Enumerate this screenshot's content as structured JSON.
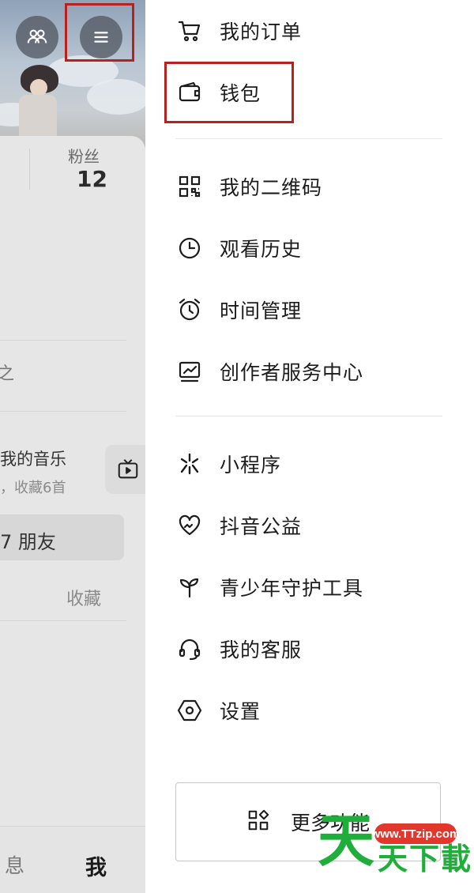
{
  "profile": {
    "fans_label": "粉丝",
    "fans_count": "12",
    "partial_text": "之",
    "music_title": "我的音乐",
    "music_subtitle": "，收藏6首",
    "friends_text": "7 朋友",
    "collect_label": "收藏",
    "tab_messages": "息",
    "tab_me": "我",
    "icons": {
      "friends": "friends-icon",
      "menu": "menu-icon",
      "tv": "tv-icon"
    }
  },
  "drawer": {
    "section1": [
      {
        "label": "我的订单",
        "icon": "cart-icon"
      },
      {
        "label": "钱包",
        "icon": "wallet-icon"
      }
    ],
    "section2": [
      {
        "label": "我的二维码",
        "icon": "qr-code-icon"
      },
      {
        "label": "观看历史",
        "icon": "clock-icon"
      },
      {
        "label": "时间管理",
        "icon": "alarm-clock-icon"
      },
      {
        "label": "创作者服务中心",
        "icon": "creator-chart-icon"
      }
    ],
    "section3": [
      {
        "label": "小程序",
        "icon": "mini-program-icon"
      },
      {
        "label": "抖音公益",
        "icon": "charity-heart-icon"
      },
      {
        "label": "青少年守护工具",
        "icon": "sprout-icon"
      },
      {
        "label": "我的客服",
        "icon": "headset-icon"
      },
      {
        "label": "设置",
        "icon": "settings-hexagon-icon"
      }
    ],
    "more_button": {
      "label": "更多功能",
      "icon": "grid-icon"
    }
  },
  "watermark": {
    "url": "www.TTzip.com",
    "glyph": "天",
    "text": "天下載"
  },
  "colors": {
    "highlight": "#b8211c",
    "watermark_red": "#e2372c",
    "watermark_green": "#1fae3a"
  }
}
